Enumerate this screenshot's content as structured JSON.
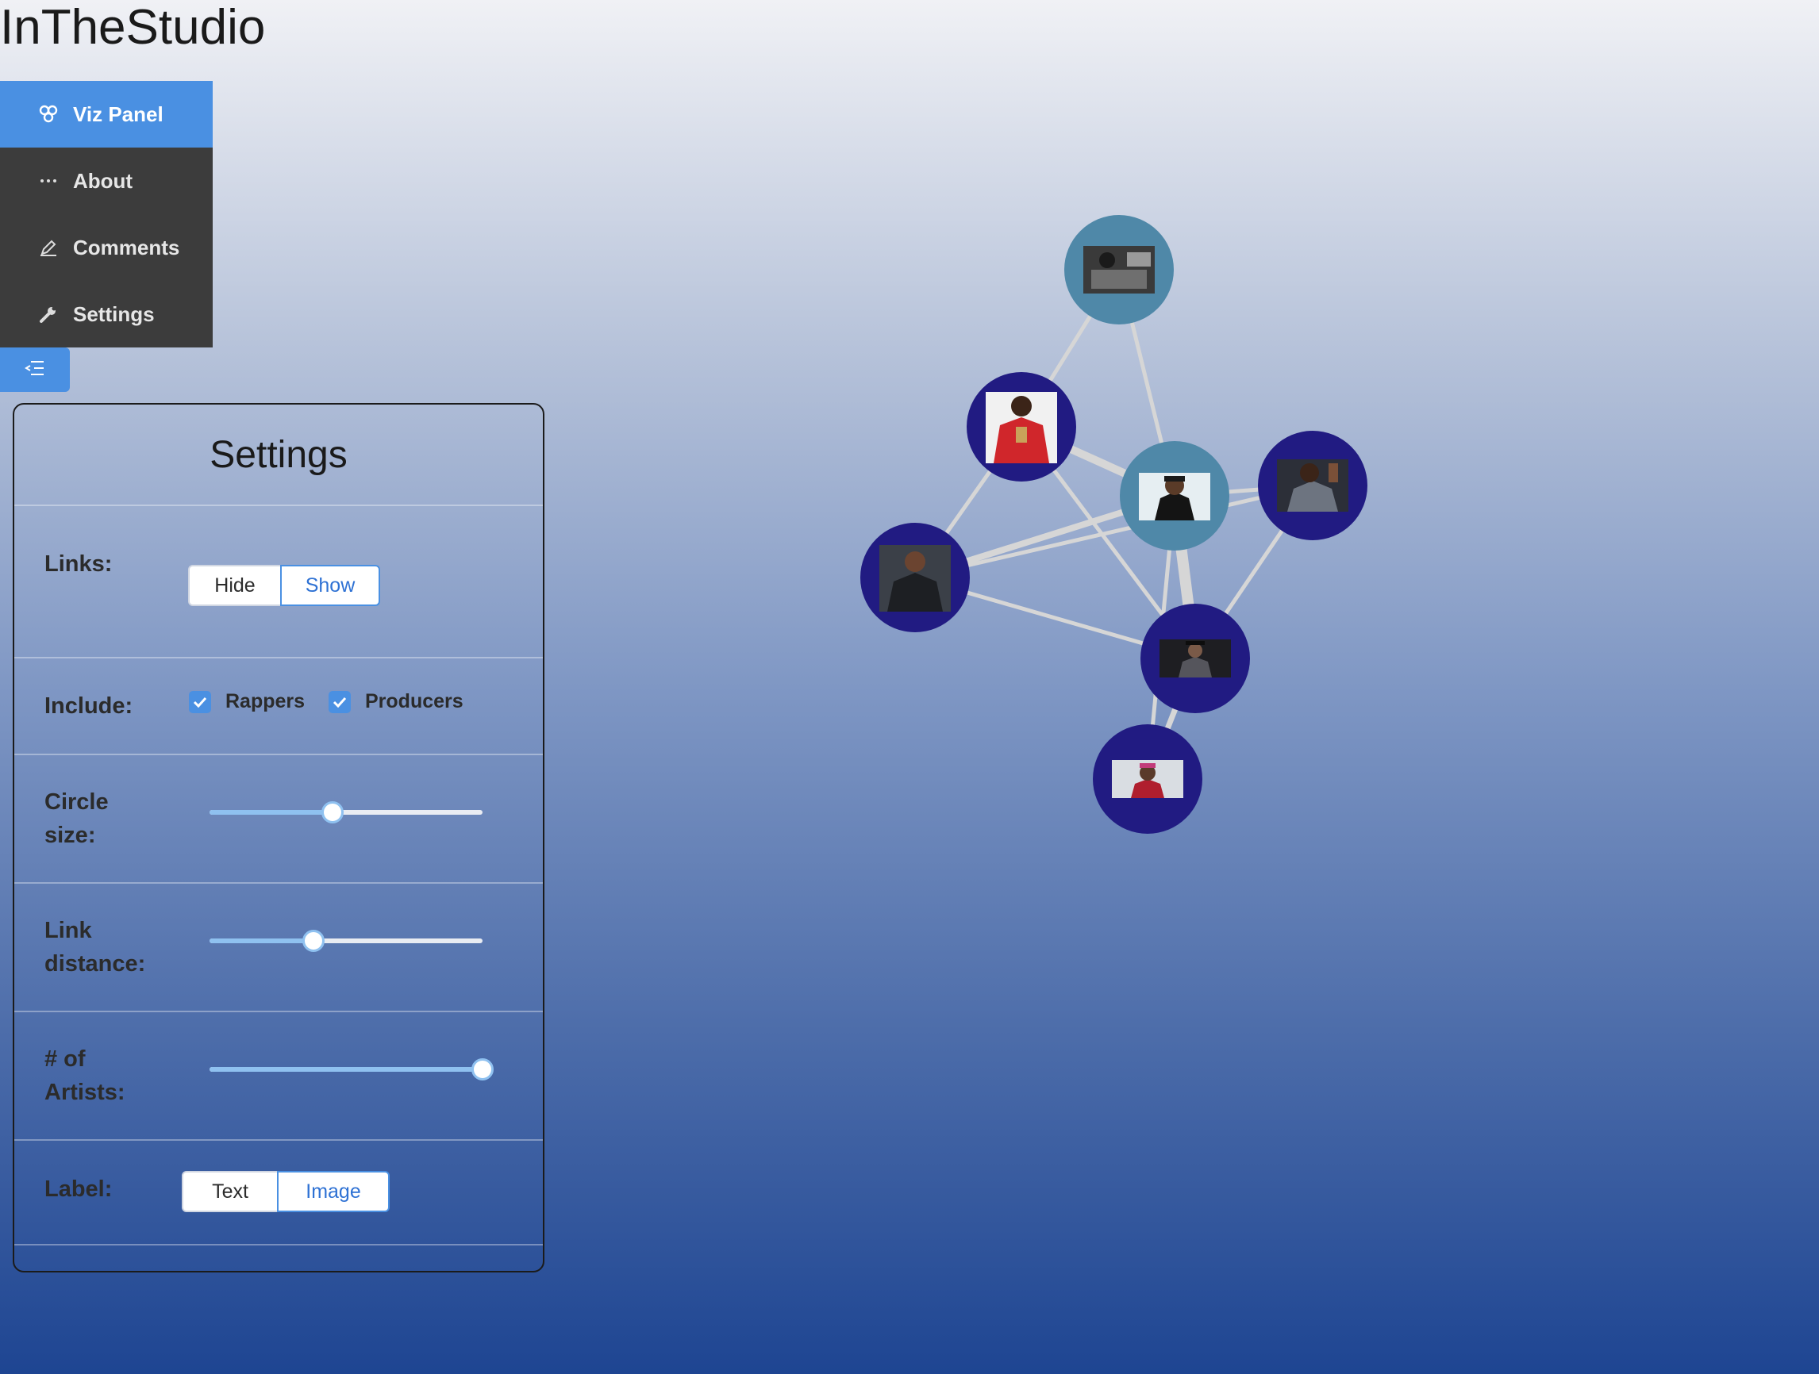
{
  "app": {
    "title": "InTheStudio"
  },
  "sidebar": {
    "items": [
      {
        "label": "Viz Panel",
        "icon": "network-icon",
        "active": true
      },
      {
        "label": "About",
        "icon": "ellipsis-icon",
        "active": false
      },
      {
        "label": "Comments",
        "icon": "pencil-icon",
        "active": false
      },
      {
        "label": "Settings",
        "icon": "wrench-icon",
        "active": false
      }
    ],
    "toggle_icon": "collapse-menu-icon",
    "accent": "#4a90e2",
    "menu_bg": "#3c3c3c"
  },
  "settings": {
    "title": "Settings",
    "links": {
      "label": "Links:",
      "options": [
        "Hide",
        "Show"
      ],
      "selected": "Show"
    },
    "include": {
      "label": "Include:",
      "options": [
        {
          "label": "Rappers",
          "checked": true
        },
        {
          "label": "Producers",
          "checked": true
        }
      ]
    },
    "circle_size": {
      "label_line1": "Circle",
      "label_line2": "size:",
      "value": 0.45
    },
    "link_distance": {
      "label_line1": "Link",
      "label_line2": "distance:",
      "value": 0.38
    },
    "num_artists": {
      "label_line1": "# of",
      "label_line2": "Artists:",
      "value": 1.0
    },
    "label": {
      "label": "Label:",
      "options": [
        "Text",
        "Image"
      ],
      "selected": "Image"
    }
  },
  "graph": {
    "producer_color": "#4f88a8",
    "rapper_color": "#211b82",
    "link_color": "#d6d6d6",
    "node_count": 7,
    "link_count": 13
  }
}
